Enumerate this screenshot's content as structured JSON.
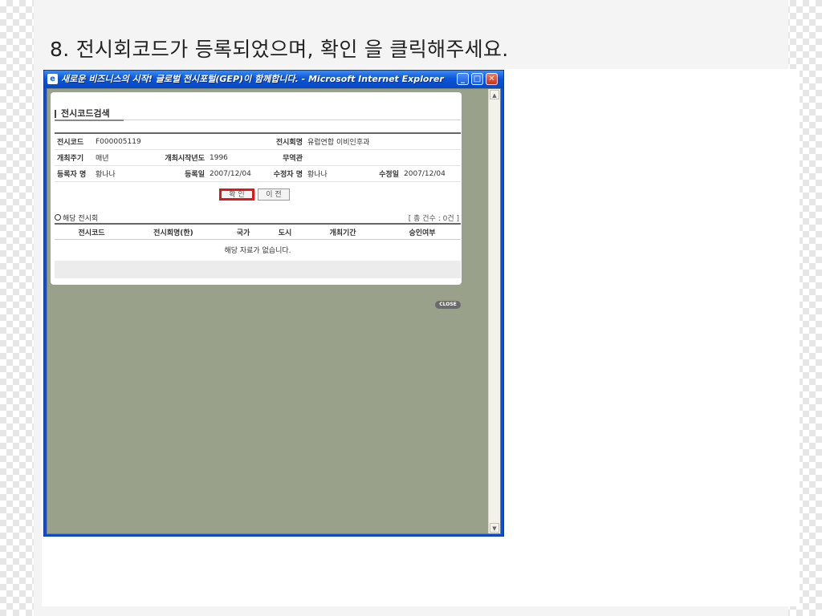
{
  "instruction": "8. 전시회코드가 등록되었으며, 확인 을 클릭해주세요.",
  "window": {
    "title": "새로운 비즈니스의 시작! 글로벌 전시포털(GEP)이 함께합니다. - Microsoft Internet Explorer",
    "icon": "e",
    "minimize": "_",
    "maximize": "□",
    "close": "✕"
  },
  "panel": {
    "title": "전시코드검색",
    "info": {
      "exhibit_code_label": "전시코드",
      "exhibit_code_value": "F000005119",
      "exhibit_name_label": "전시회명",
      "exhibit_name_value": "유럽연합 이비인후과",
      "cycle_label": "개최주기",
      "cycle_value": "매년",
      "start_year_label": "개최시작년도",
      "start_year_value": "1996",
      "trade_hall_label": "무역관",
      "trade_hall_value": "",
      "registrant_label": "등록자 명",
      "registrant_value": "황나나",
      "reg_date_label": "등록일",
      "reg_date_value": "2007/12/04",
      "modifier_label": "수정자 명",
      "modifier_value": "황나나",
      "mod_date_label": "수정일",
      "mod_date_value": "2007/12/04"
    },
    "confirm_button": "확 인",
    "prev_button": "이 전",
    "section_label": "해당 전시회",
    "count_label": "[ 총 건수 : 0건 ]",
    "columns": [
      "전시코드",
      "전시회명(한)",
      "국가",
      "도시",
      "개최기간",
      "승인여부"
    ],
    "empty_message": "해당 자료가 없습니다.",
    "close_label": "CLOSE"
  },
  "colors": {
    "highlight": "#e01818",
    "titlebar": "#0b56d8",
    "client_bg": "#99a18a"
  }
}
